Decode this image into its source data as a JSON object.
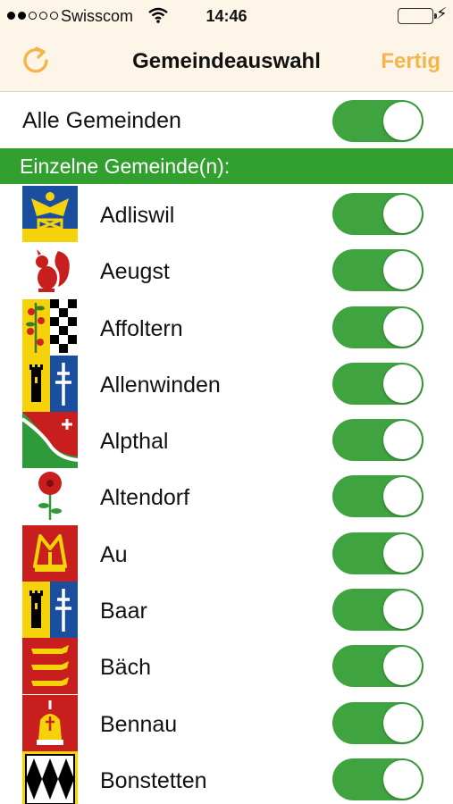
{
  "status": {
    "carrier": "Swisscom",
    "time": "14:46"
  },
  "nav": {
    "title": "Gemeindeauswahl",
    "done_label": "Fertig",
    "accent": "#f6b44a"
  },
  "all_row": {
    "label": "Alle Gemeinden",
    "on": true
  },
  "section": {
    "label": "Einzelne Gemeinde(n):",
    "color": "#32a02e"
  },
  "toggle_on_color": "#3fa33f",
  "communes": [
    {
      "name": "Adliswil",
      "on": true
    },
    {
      "name": "Aeugst",
      "on": true
    },
    {
      "name": "Affoltern",
      "on": true
    },
    {
      "name": "Allenwinden",
      "on": true
    },
    {
      "name": "Alpthal",
      "on": true
    },
    {
      "name": "Altendorf",
      "on": true
    },
    {
      "name": "Au",
      "on": true
    },
    {
      "name": "Baar",
      "on": true
    },
    {
      "name": "Bäch",
      "on": true
    },
    {
      "name": "Bennau",
      "on": true
    },
    {
      "name": "Bonstetten",
      "on": true
    }
  ]
}
